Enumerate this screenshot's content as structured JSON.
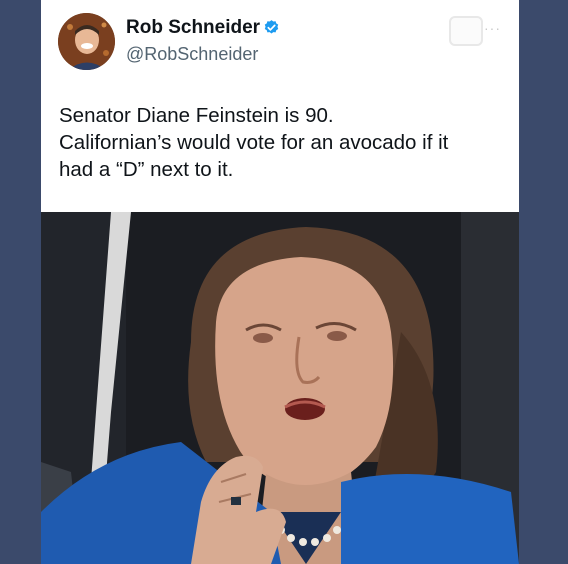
{
  "tweet": {
    "author_name": "Rob Schneider",
    "author_handle": "@RobSchneider",
    "verified": true,
    "text_lines": [
      "Senator Diane Feinstein is 90.",
      "Californian’s would vote for an avocado if it",
      "had a “D” next to it."
    ]
  },
  "icons": {
    "avatar": "avatar",
    "verified": "verified-badge-icon",
    "share": "share-icon",
    "more": "more-icon"
  },
  "colors": {
    "background": "#3b4a6b",
    "card": "#ffffff",
    "verified_badge": "#1d9bf0",
    "name": "#0f1419",
    "handle": "#536471"
  }
}
